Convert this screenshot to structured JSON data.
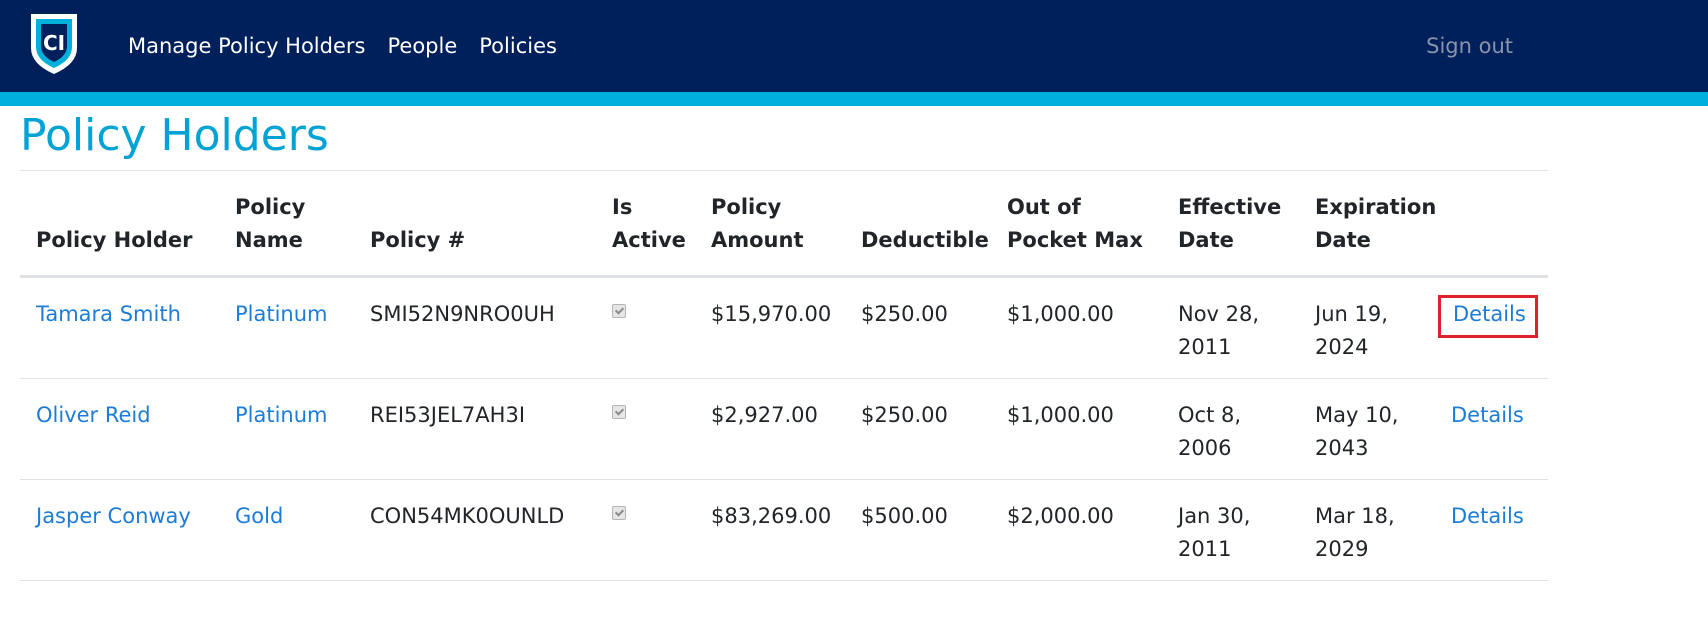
{
  "nav": {
    "logo_text": "CI",
    "links": [
      "Manage Policy Holders",
      "People",
      "Policies"
    ],
    "signout": "Sign out"
  },
  "page": {
    "title": "Policy Holders"
  },
  "table": {
    "headers": [
      "Policy Holder",
      "Policy Name",
      "Policy #",
      "Is Active",
      "Policy Amount",
      "Deductible",
      "Out of Pocket Max",
      "Effective Date",
      "Expiration Date",
      ""
    ],
    "rows": [
      {
        "holder": "Tamara Smith",
        "policy_name": "Platinum",
        "policy_no": "SMI52N9NRO0UH",
        "is_active": true,
        "amount": "$15,970.00",
        "deductible": "$250.00",
        "oop_max": "$1,000.00",
        "effective": "Nov 28, 2011",
        "expiration": "Jun 19, 2024",
        "details": "Details",
        "highlighted": true
      },
      {
        "holder": "Oliver Reid",
        "policy_name": "Platinum",
        "policy_no": "REI53JEL7AH3I",
        "is_active": true,
        "amount": "$2,927.00",
        "deductible": "$250.00",
        "oop_max": "$1,000.00",
        "effective": "Oct 8, 2006",
        "expiration": "May 10, 2043",
        "details": "Details",
        "highlighted": false
      },
      {
        "holder": "Jasper Conway",
        "policy_name": "Gold",
        "policy_no": "CON54MK0OUNLD",
        "is_active": true,
        "amount": "$83,269.00",
        "deductible": "$500.00",
        "oop_max": "$2,000.00",
        "effective": "Jan 30, 2011",
        "expiration": "Mar 18, 2029",
        "details": "Details",
        "highlighted": false
      }
    ]
  },
  "colors": {
    "nav_bg": "#00205b",
    "accent": "#00b0dc",
    "title": "#00a3d4",
    "link": "#1c7cd6",
    "highlight_border": "#e0202b"
  }
}
